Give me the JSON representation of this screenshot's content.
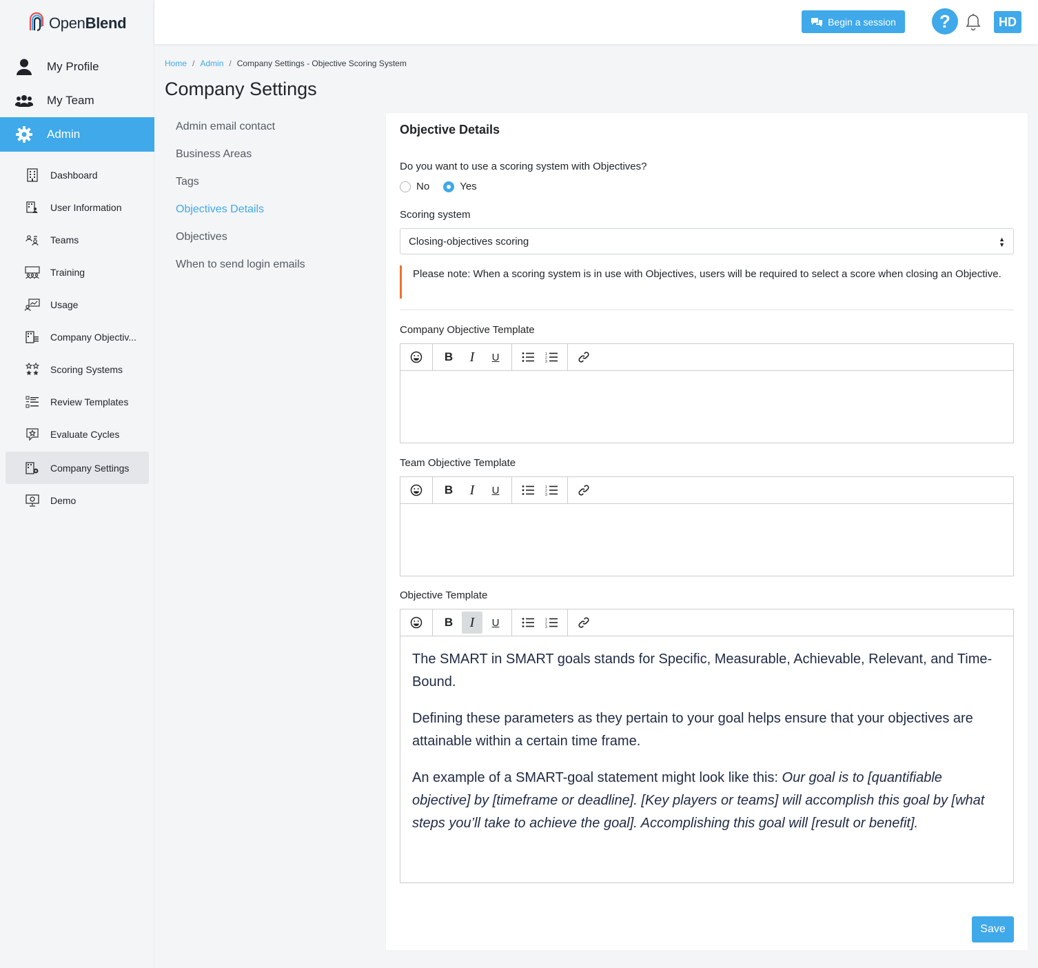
{
  "brand": {
    "name_prefix": "Open",
    "name_suffix": "Blend"
  },
  "header": {
    "begin_session": "Begin a session",
    "help": "?",
    "avatar_initials": "HD"
  },
  "nav": {
    "top": [
      {
        "label": "My Profile",
        "icon": "user-icon"
      },
      {
        "label": "My Team",
        "icon": "users-icon"
      },
      {
        "label": "Admin",
        "icon": "gear-icon"
      }
    ],
    "sub": [
      {
        "label": "Dashboard",
        "icon": "building-icon"
      },
      {
        "label": "User Information",
        "icon": "user-info-icon"
      },
      {
        "label": "Teams",
        "icon": "teams-icon"
      },
      {
        "label": "Training",
        "icon": "training-icon"
      },
      {
        "label": "Usage",
        "icon": "usage-icon"
      },
      {
        "label": "Company Objectiv...",
        "icon": "company-objectives-icon"
      },
      {
        "label": "Scoring Systems",
        "icon": "stars-icon"
      },
      {
        "label": "Review Templates",
        "icon": "list-icon"
      },
      {
        "label": "Evaluate Cycles",
        "icon": "evaluate-icon"
      },
      {
        "label": "Company Settings",
        "icon": "company-settings-icon"
      },
      {
        "label": "Demo",
        "icon": "monitor-icon"
      }
    ]
  },
  "breadcrumb": {
    "home": "Home",
    "admin": "Admin",
    "current": "Company Settings - Objective Scoring System"
  },
  "page_title": "Company Settings",
  "settings_menu": [
    "Admin email contact",
    "Business Areas",
    "Tags",
    "Objectives Details",
    "Objectives",
    "When to send login emails"
  ],
  "card": {
    "title": "Objective Details",
    "question": "Do you want to use a scoring system with Objectives?",
    "radio_no": "No",
    "radio_yes": "Yes",
    "selected": "Yes",
    "scoring_label": "Scoring system",
    "scoring_value": "Closing-objectives scoring",
    "note": "Please note: When a scoring system is in use with Objectives, users will be required to select a score when closing an Objective.",
    "company_template_label": "Company Objective Template",
    "team_template_label": "Team Objective Template",
    "objective_template_label": "Objective Template",
    "objective_template": {
      "p1": "The SMART in SMART goals stands for Specific, Measurable, Achievable, Relevant, and Time-Bound.",
      "p2": "Defining these parameters as they pertain to your goal helps ensure that your objectives are attainable within a certain time frame.",
      "p3_plain": "An example of a SMART-goal statement might look like this: ",
      "p3_italic": "Our goal is to [quantifiable objective] by [timeframe or deadline]. [Key players or teams] will accomplish this goal by [what steps you’ll take to achieve the goal]. Accomplishing this goal will [result or benefit]."
    },
    "toolbar": {
      "bold": "B",
      "italic": "I",
      "underline": "U"
    },
    "save": "Save"
  },
  "colors": {
    "accent": "#3fa9ea",
    "note_border": "#f0712c"
  }
}
